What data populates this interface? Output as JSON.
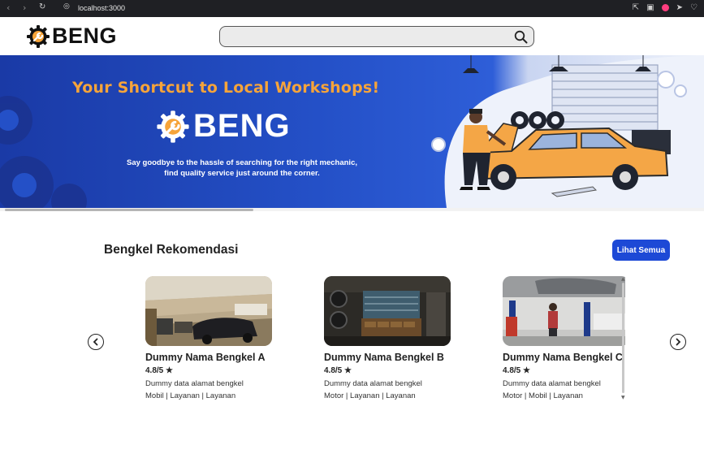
{
  "browser": {
    "url": "localhost:3000"
  },
  "header": {
    "logo_text": "BENG",
    "search_placeholder": ""
  },
  "banner": {
    "headline": "Your Shortcut to Local Workshops!",
    "logo_text": "BENG",
    "tagline_line1": "Say goodbye to the hassle of searching for the right mechanic,",
    "tagline_line2": "find quality service just around the corner."
  },
  "recommendations": {
    "title": "Bengkel Rekomendasi",
    "see_all_label": "Lihat Semua",
    "cards": [
      {
        "name": "Dummy Nama Bengkel A",
        "rating": "4.8/5",
        "address": "Dummy data alamat bengkel",
        "services": "Mobil | Layanan | Layanan"
      },
      {
        "name": "Dummy Nama Bengkel B",
        "rating": "4.8/5",
        "address": "Dummy data alamat bengkel",
        "services": "Motor | Layanan | Layanan"
      },
      {
        "name": "Dummy Nama Bengkel C",
        "rating": "4.8/5",
        "address": "Dummy data alamat bengkel",
        "services": "Motor | Mobil | Layanan"
      }
    ]
  },
  "colors": {
    "brand_blue": "#1d49d6",
    "accent_orange": "#f6a43a"
  }
}
